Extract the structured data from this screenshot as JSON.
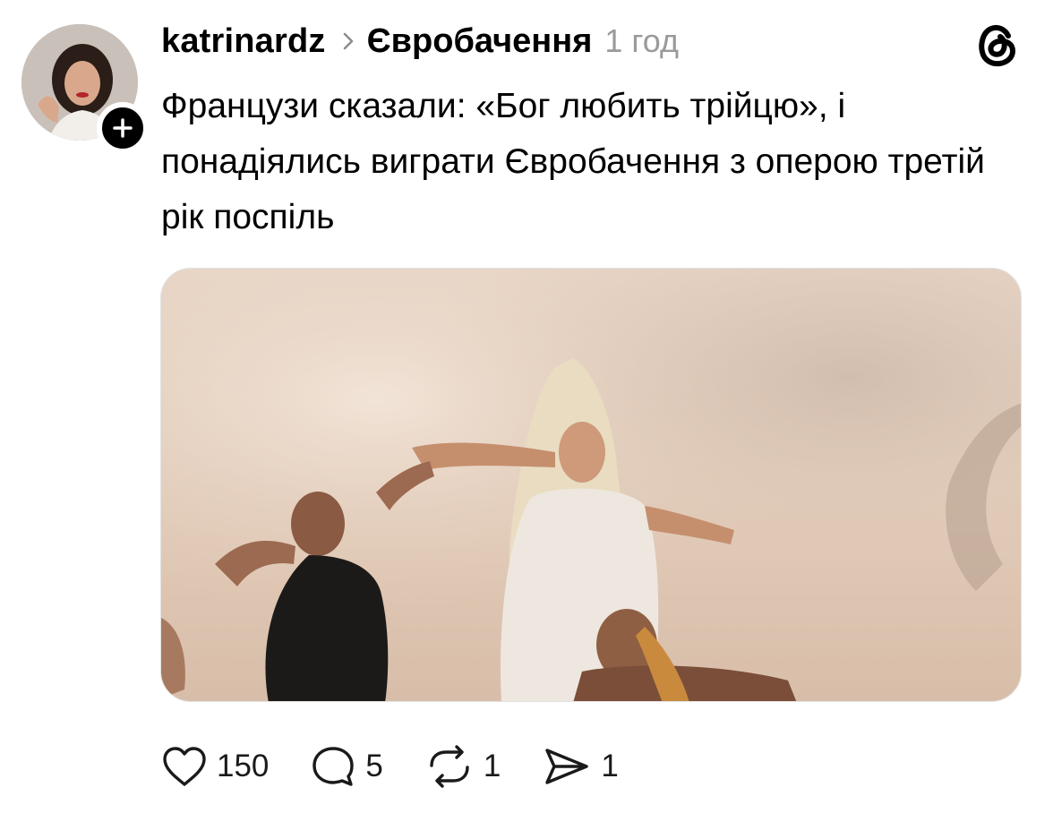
{
  "author": {
    "username": "katrinardz",
    "avatar_icon": "avatar-photo",
    "follow_icon": "plus-icon"
  },
  "topic": "Євробачення",
  "time": "1 год",
  "post_text": "Французи сказали: «Бог любить трійцю», і понадіялись виграти Євробачення з оперою третій рік поспіль",
  "actions": {
    "likes": "150",
    "comments": "5",
    "reposts": "1",
    "shares": "1"
  },
  "colors": {
    "text": "#000000",
    "muted": "#9a9a9a",
    "badge": "#000000"
  }
}
